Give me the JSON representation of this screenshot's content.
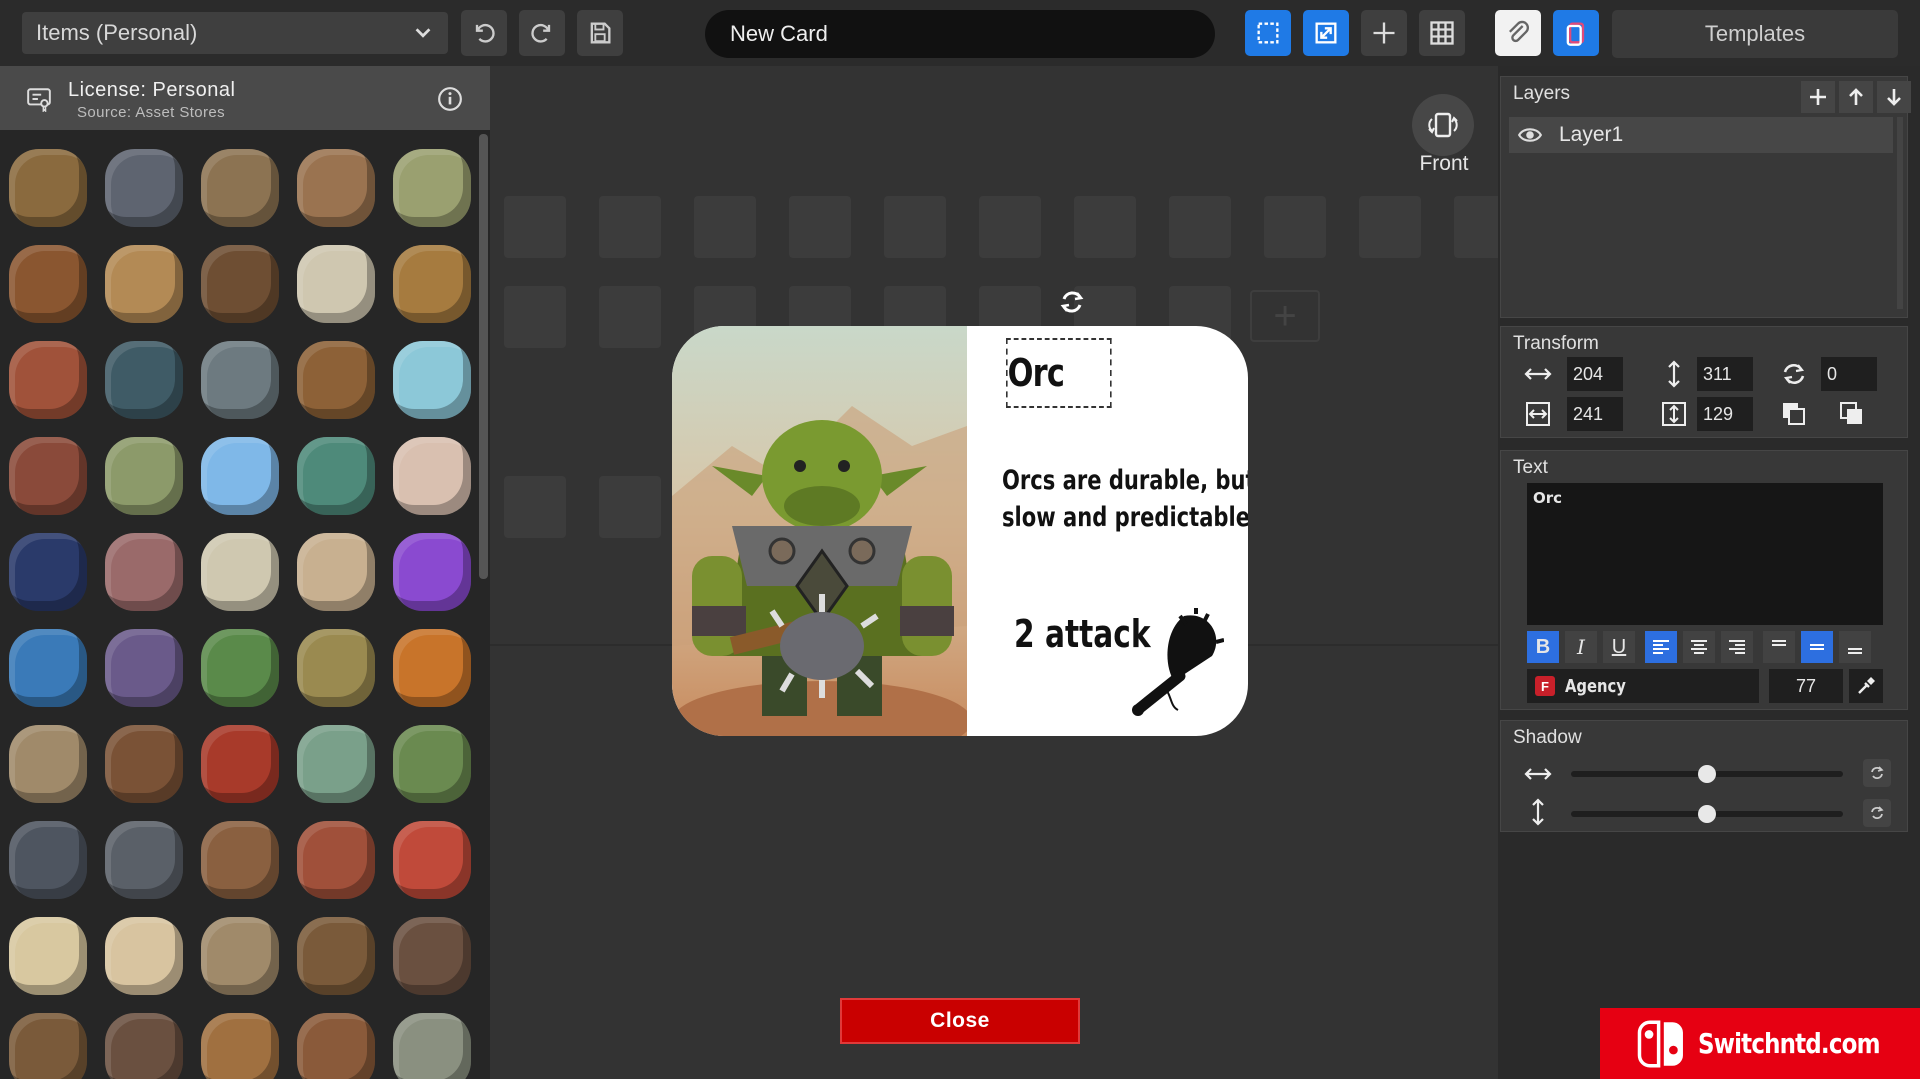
{
  "toolbar": {
    "collection_select": "Items (Personal)",
    "card_name": "New Card",
    "templates_label": "Templates"
  },
  "license": {
    "title": "License: Personal",
    "source": "Source: Asset Stores"
  },
  "icon_library": [
    {
      "name": "basket",
      "color": "#8a6a3e"
    },
    {
      "name": "anvil",
      "color": "#5e6470"
    },
    {
      "name": "sack",
      "color": "#8c7352"
    },
    {
      "name": "pouch",
      "color": "#9a7350"
    },
    {
      "name": "herb-sack",
      "color": "#9aa070"
    },
    {
      "name": "barrel",
      "color": "#8a5630"
    },
    {
      "name": "mug",
      "color": "#b38a55"
    },
    {
      "name": "coconut",
      "color": "#6e4e33"
    },
    {
      "name": "bones",
      "color": "#cfc7b0"
    },
    {
      "name": "broom",
      "color": "#a67b3f"
    },
    {
      "name": "cards",
      "color": "#a0523a"
    },
    {
      "name": "cauldron",
      "color": "#3f5b66"
    },
    {
      "name": "skull-coin",
      "color": "#6d7a80"
    },
    {
      "name": "crate",
      "color": "#8d6137"
    },
    {
      "name": "jar",
      "color": "#8cc8d8"
    },
    {
      "name": "vase",
      "color": "#8a4a3a"
    },
    {
      "name": "bottle",
      "color": "#8c9a6a"
    },
    {
      "name": "potion",
      "color": "#7fb8e8"
    },
    {
      "name": "green-jar",
      "color": "#4e8a7a"
    },
    {
      "name": "eyeball",
      "color": "#d9c0b0"
    },
    {
      "name": "orb",
      "color": "#2a3a6a"
    },
    {
      "name": "feather",
      "color": "#9a6a6a"
    },
    {
      "name": "fish-skeleton",
      "color": "#cfc8b0"
    },
    {
      "name": "skull",
      "color": "#c8b090"
    },
    {
      "name": "crystal",
      "color": "#8a4ad0"
    },
    {
      "name": "blue-vial",
      "color": "#3a7ab8"
    },
    {
      "name": "claw",
      "color": "#6a5a8a"
    },
    {
      "name": "cabbage",
      "color": "#5a8a4a"
    },
    {
      "name": "mandrake",
      "color": "#9a8a50"
    },
    {
      "name": "pumpkin",
      "color": "#c8742a"
    },
    {
      "name": "bowl",
      "color": "#a08a6a"
    },
    {
      "name": "pinecone",
      "color": "#7a5236"
    },
    {
      "name": "spice-pile",
      "color": "#a83a2a"
    },
    {
      "name": "mortar",
      "color": "#7aa08a"
    },
    {
      "name": "plant",
      "color": "#6a8a50"
    },
    {
      "name": "ingots",
      "color": "#4e5560"
    },
    {
      "name": "stone",
      "color": "#5a6068"
    },
    {
      "name": "mask",
      "color": "#8a6040"
    },
    {
      "name": "meat",
      "color": "#a0503a"
    },
    {
      "name": "mushroom",
      "color": "#c04a3a"
    },
    {
      "name": "scroll-skull",
      "color": "#d8c8a0"
    },
    {
      "name": "scroll",
      "color": "#d8c4a0"
    },
    {
      "name": "rope",
      "color": "#a08a6a"
    },
    {
      "name": "sticks",
      "color": "#7a5a3a"
    },
    {
      "name": "flask",
      "color": "#6a5040"
    },
    {
      "name": "chest",
      "color": "#7a5a3a"
    },
    {
      "name": "bell",
      "color": "#6a5040"
    },
    {
      "name": "horn",
      "color": "#a07040"
    },
    {
      "name": "log",
      "color": "#8a5a3a"
    },
    {
      "name": "leaf-stone",
      "color": "#8a9080"
    }
  ],
  "editor": {
    "front_label": "Front",
    "close_label": "Close",
    "card": {
      "title": "Orc",
      "description_line1": "Orcs are durable, but",
      "description_line2": "slow and predictable.",
      "attack": "2 attack"
    }
  },
  "layers_panel": {
    "title": "Layers",
    "layers": [
      {
        "name": "Layer1"
      }
    ]
  },
  "transform_panel": {
    "title": "Transform",
    "width": "204",
    "height": "311",
    "rotation": "0",
    "x": "241",
    "y": "129"
  },
  "text_panel": {
    "title": "Text",
    "content": "Orc",
    "font": "Agency",
    "size": "77"
  },
  "shadow_panel": {
    "title": "Shadow",
    "x_offset": 0.5,
    "y_offset": 0.5
  },
  "watermark": {
    "text": "Switchntd.com"
  },
  "colors": {
    "accent": "#1f7ae6",
    "close": "#c90000",
    "watermark": "#e60012"
  }
}
